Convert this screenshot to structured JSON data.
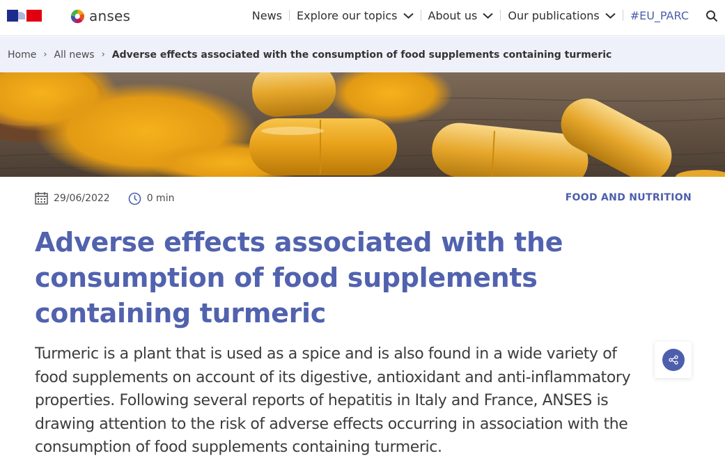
{
  "header": {
    "logo_text": "anses",
    "nav": [
      {
        "label": "News"
      },
      {
        "label": "Explore our topics"
      },
      {
        "label": "About us"
      },
      {
        "label": "Our publications"
      },
      {
        "label": "#EU_PARC"
      }
    ]
  },
  "breadcrumb": {
    "items": [
      "Home",
      "All news"
    ],
    "current": "Adverse effects associated with the consumption of food supplements containing turmeric"
  },
  "hero": {
    "icon": "turmeric-capsules-photo"
  },
  "article": {
    "date": "29/06/2022",
    "reading_time": "0 min",
    "category": "FOOD AND NUTRITION",
    "title": "Adverse effects associated with the consumption of food supplements containing turmeric",
    "lead": "Turmeric is a plant that is used as a spice and is also found in a wide variety of food supplements on account of its digestive, antioxidant and anti-inflammatory properties. Following several reports of hepatitis in Italy and France, ANSES is drawing attention to the risk of adverse effects occurring in association with the consumption of food supplements containing turmeric."
  },
  "colors": {
    "accent": "#4d5eac",
    "title": "#5162ae",
    "breadcrumb_bg": "#eef1fa",
    "turmeric": "#e8a317"
  }
}
